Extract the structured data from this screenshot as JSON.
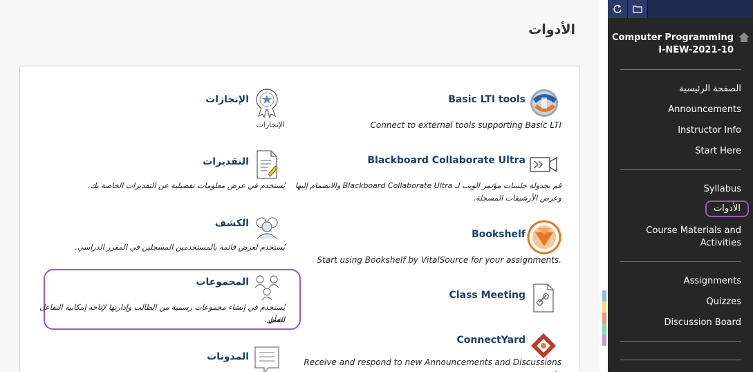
{
  "page": {
    "title": "الأدوات"
  },
  "tools": [
    {
      "name": "Basic LTI tools",
      "desc": "Connect to external tools supporting Basic LTI",
      "icon": "globe-lti-icon"
    },
    {
      "name": "الإنجازات",
      "desc": "الإنجازات",
      "icon": "achievement-badge-icon"
    },
    {
      "name": "Blackboard Collaborate Ultra",
      "desc1": "قم بجدولة جلسات مؤتمر الويب لـ Blackboard Collaborate Ultra والانضمام إليها",
      "desc2": "وعرض الأرشيفات المسجلة.",
      "icon": "video-camera-icon"
    },
    {
      "name": "التقديرات",
      "desc": "يُستخدم في عرض معلومات تفصيلية عن التقديرات الخاصة بك.",
      "icon": "grades-document-icon"
    },
    {
      "name": "Bookshelf",
      "desc": "Start using Bookshelf by VitalSource for your assignments.",
      "icon": "bookshelf-icon"
    },
    {
      "name": "الكشف",
      "desc": "يُستخدم لعرض قائمة بالمستخدمين المسجلين في المقرر الدراسي.",
      "icon": "roster-users-icon"
    },
    {
      "name": "Class Meeting",
      "desc": "",
      "icon": "class-meeting-link-icon"
    },
    {
      "name": "المجموعات",
      "desc1": "يُستخدم في إنشاء مجموعات رسمية من الطالب وإدارتها لإتاحة إمكانية التفاعل بشأن",
      "desc2": "العمل.",
      "icon": "groups-icon"
    },
    {
      "name": "ConnectYard",
      "desc": "Receive and respond to new Announcements and Discussions via",
      "icon": "connectyard-icon"
    },
    {
      "name": "المدونات",
      "desc": "",
      "icon": "blog-icon"
    }
  ],
  "sidebar": {
    "course_title": "Computer Programming I-NEW-2021-10",
    "group1": [
      "الصفحة الرئيسية",
      "Announcements",
      "Instructor Info",
      "Start Here"
    ],
    "group2": [
      "Syllabus",
      "الأدوات",
      "Course Materials and Activities"
    ],
    "group3": [
      "Assignments",
      "Quizzes",
      "Discussion Board"
    ]
  },
  "colors": {
    "tool_name": "#1a3e6e",
    "sidebar_bg": "#262626",
    "highlight": "#9b59b6"
  }
}
